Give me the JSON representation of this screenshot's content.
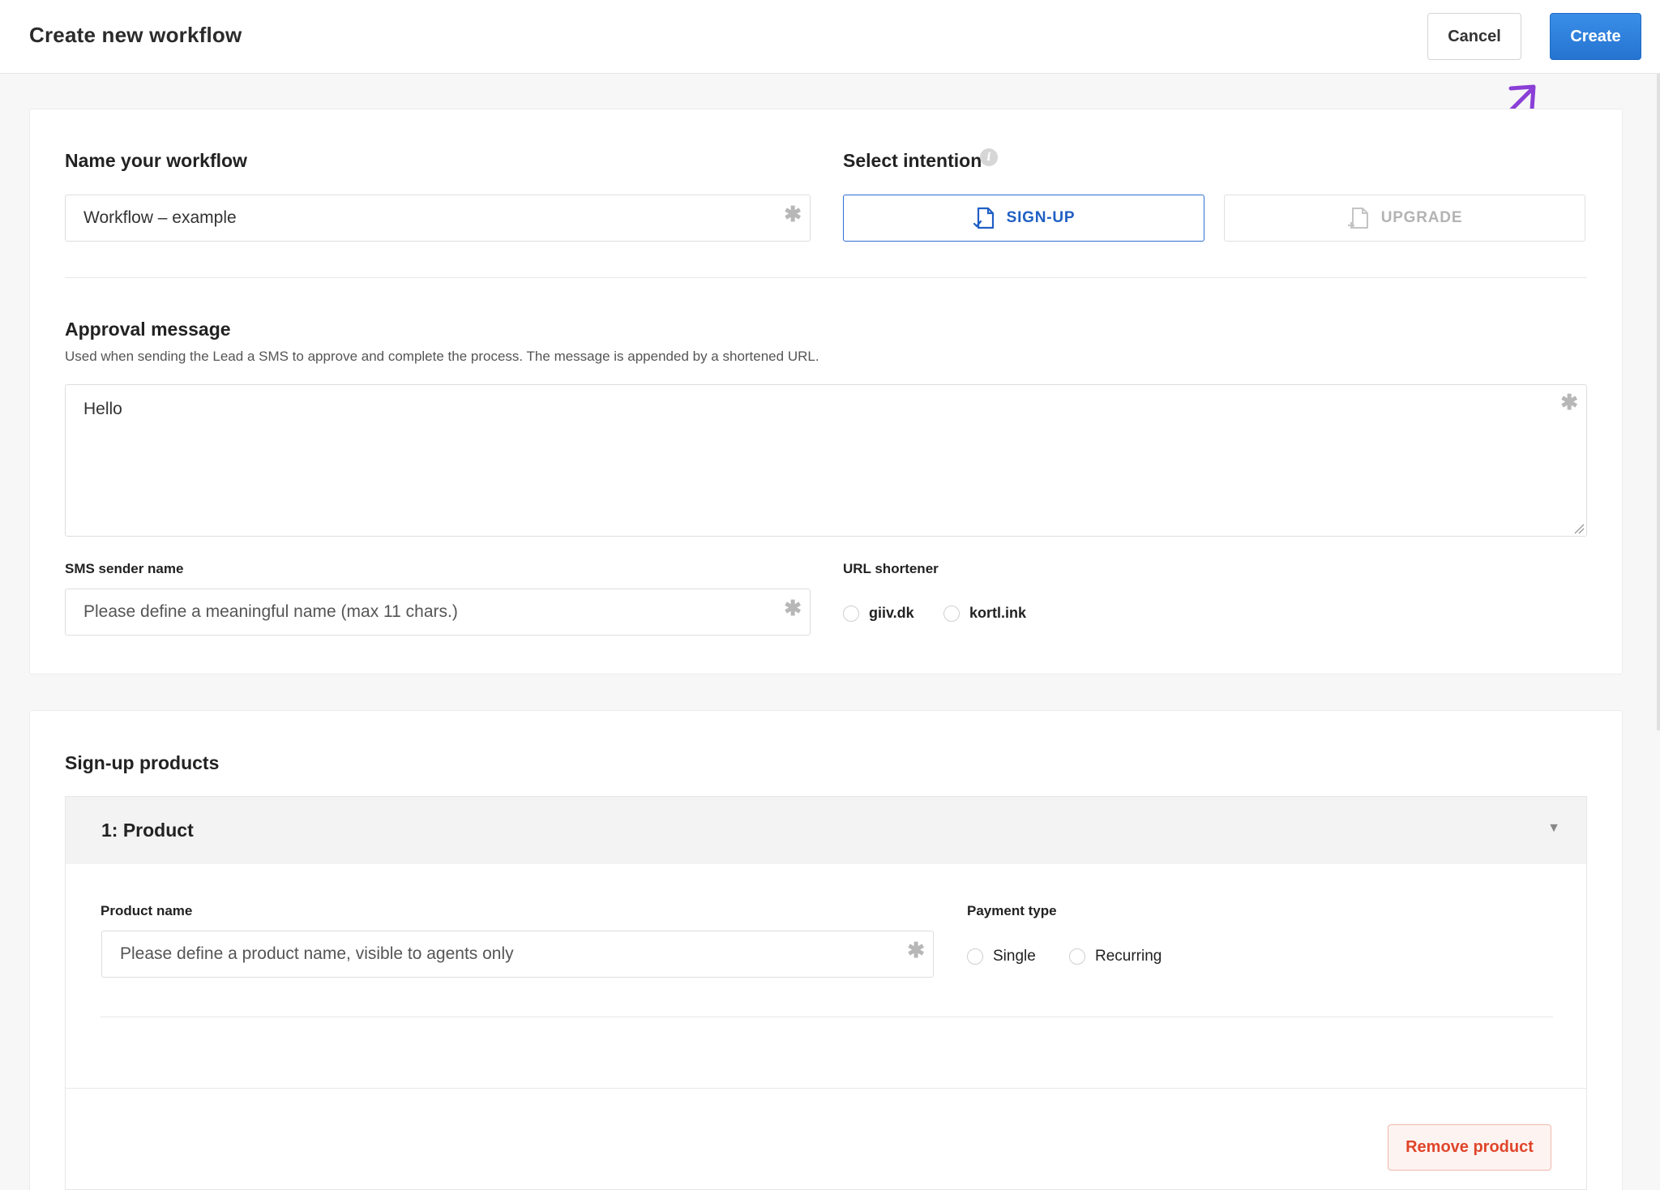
{
  "header": {
    "title": "Create new workflow",
    "cancel_label": "Cancel",
    "create_label": "Create"
  },
  "workflow": {
    "name_label": "Name your workflow",
    "name_value": "Workflow – example",
    "required_mark": "✱",
    "intention_label": "Select intention",
    "info_glyph": "i",
    "intentions": [
      {
        "label": "SIGN-UP",
        "selected": true,
        "icon": "document-check-icon"
      },
      {
        "label": "UPGRADE",
        "selected": false,
        "icon": "document-plus-icon"
      }
    ]
  },
  "approval": {
    "title": "Approval message",
    "help": "Used when sending the Lead a SMS to approve and complete the process. The message is appended by a shortened URL.",
    "message": "Hello"
  },
  "sms": {
    "sender_label": "SMS sender name",
    "sender_placeholder": "Please define a meaningful name (max 11 chars.)"
  },
  "url_shortener": {
    "label": "URL shortener",
    "options": [
      "giiv.dk",
      "kortl.ink"
    ]
  },
  "products": {
    "title": "Sign-up products",
    "items": [
      {
        "header": "1: Product",
        "name_label": "Product name",
        "name_placeholder": "Please define a product name, visible to agents only",
        "payment_label": "Payment type",
        "payment_options": [
          "Single",
          "Recurring"
        ],
        "remove_label": "Remove product"
      }
    ]
  },
  "colors": {
    "accent": "#2574d1",
    "annotation_arrow": "#8a3fd6",
    "danger": "#e0452a"
  }
}
